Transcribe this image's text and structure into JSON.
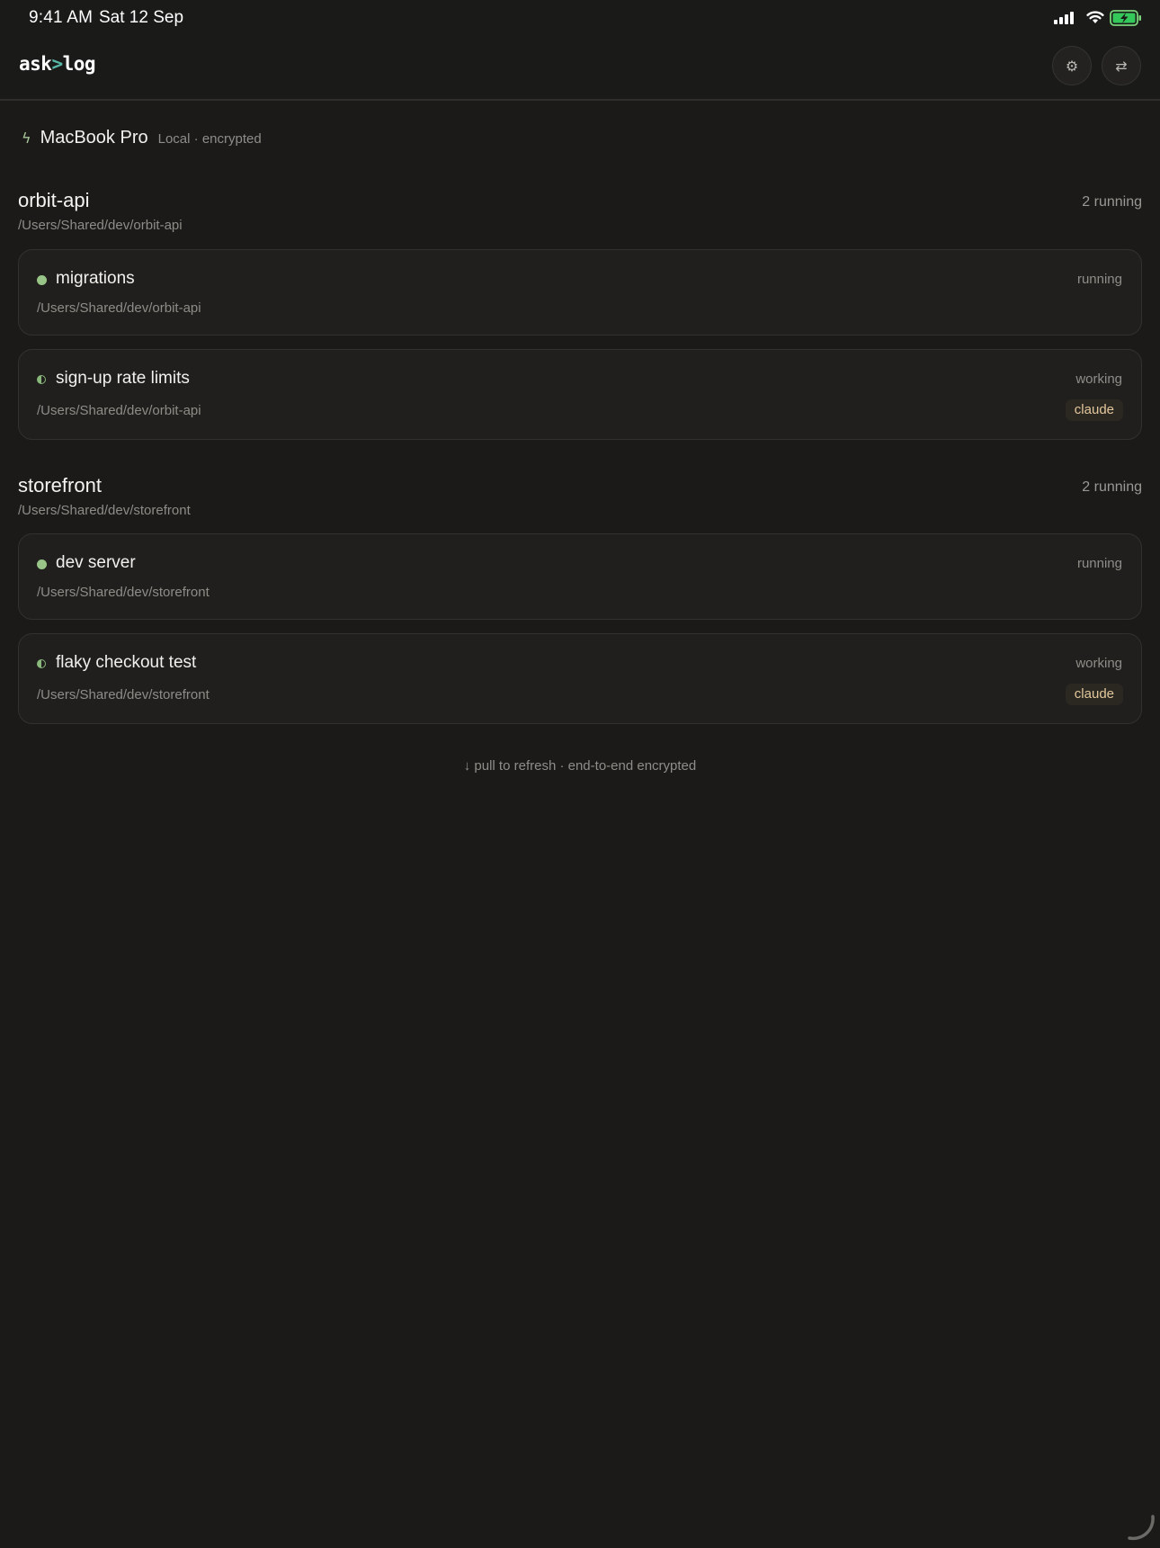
{
  "status_bar": {
    "time": "9:41 AM",
    "date": "Sat 12 Sep"
  },
  "header": {
    "logo_prefix": "ask",
    "logo_caret": ">",
    "logo_suffix": "log",
    "settings_icon": "⚙",
    "switch_icon": "⇄"
  },
  "machine": {
    "icon": "ϟ",
    "name": "MacBook Pro",
    "meta": "Local · encrypted"
  },
  "groups": [
    {
      "name": "orbit-api",
      "count": "2 running",
      "path": "/Users/Shared/dev/orbit-api",
      "sessions": [
        {
          "title": "migrations",
          "status": "running",
          "path": "/Users/Shared/dev/orbit-api",
          "badge": ""
        },
        {
          "title": "sign-up rate limits",
          "status": "working",
          "path": "/Users/Shared/dev/orbit-api",
          "badge": "claude"
        }
      ]
    },
    {
      "name": "storefront",
      "count": "2 running",
      "path": "/Users/Shared/dev/storefront",
      "sessions": [
        {
          "title": "dev server",
          "status": "running",
          "path": "/Users/Shared/dev/storefront",
          "badge": ""
        },
        {
          "title": "flaky checkout test",
          "status": "working",
          "path": "/Users/Shared/dev/storefront",
          "badge": "claude"
        }
      ]
    }
  ],
  "footer": {
    "note": "↓ pull to refresh · end-to-end encrypted"
  },
  "colors": {
    "background": "#1b1a19",
    "running_dot": "#98c587",
    "logo_caret": "#58b8a8",
    "badge_text": "#e3c79c"
  }
}
